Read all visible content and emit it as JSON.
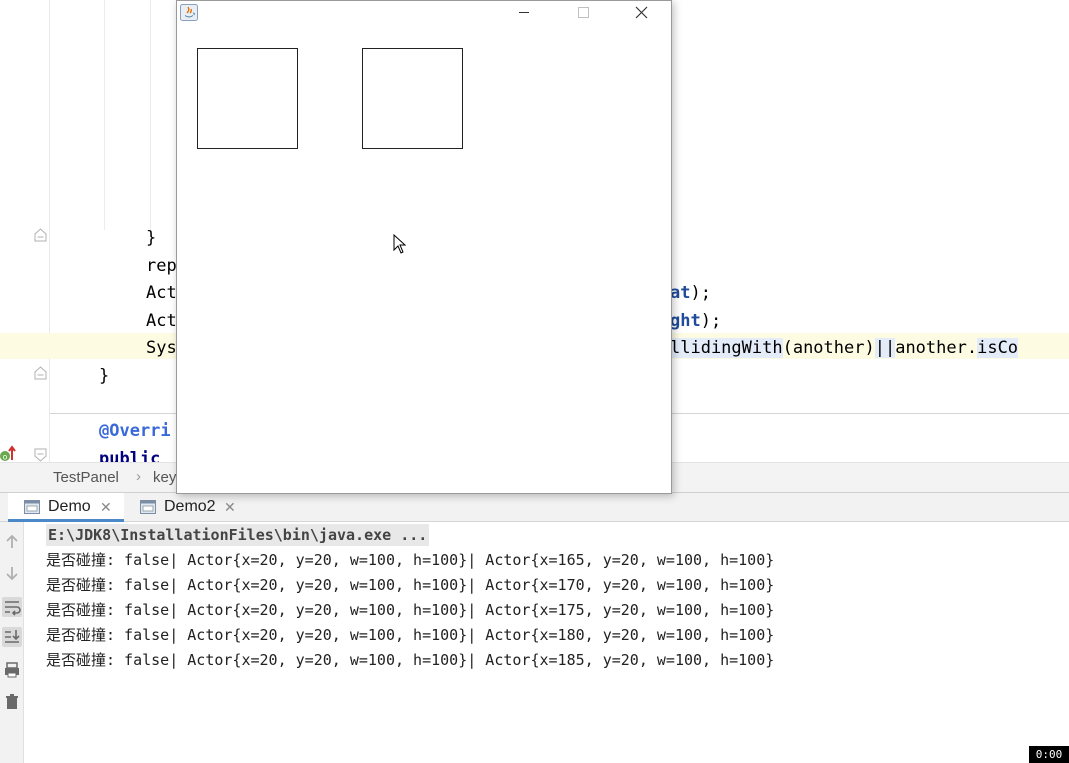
{
  "editor": {
    "lines": [
      {
        "text": "}"
      },
      {
        "text": "rep"
      },
      {
        "text": "Act"
      },
      {
        "text": "at",
        "suffix": ");"
      },
      {
        "text": "Act"
      },
      {
        "text": "ght",
        "suffix": ");"
      },
      {
        "text": "Sys"
      },
      {
        "pre": "llidingWith",
        "mid": "(another)",
        "pipes": "||",
        "tail": "another.",
        "hltail": "isCo"
      },
      {
        "text": "}"
      },
      {
        "text": "@Overri"
      },
      {
        "text": "public"
      }
    ]
  },
  "breadcrumb": {
    "items": [
      "TestPanel",
      "key"
    ]
  },
  "run": {
    "tabs": [
      {
        "label": "Demo",
        "active": true
      },
      {
        "label": "Demo2",
        "active": false
      }
    ],
    "command": "E:\\JDK8\\InstallationFiles\\bin\\java.exe ...",
    "output": [
      "是否碰撞: false| Actor{x=20, y=20, w=100, h=100}| Actor{x=165, y=20, w=100, h=100}",
      "是否碰撞: false| Actor{x=20, y=20, w=100, h=100}| Actor{x=170, y=20, w=100, h=100}",
      "是否碰撞: false| Actor{x=20, y=20, w=100, h=100}| Actor{x=175, y=20, w=100, h=100}",
      "是否碰撞: false| Actor{x=20, y=20, w=100, h=100}| Actor{x=180, y=20, w=100, h=100}",
      "是否碰撞: false| Actor{x=20, y=20, w=100, h=100}| Actor{x=185, y=20, w=100, h=100}"
    ],
    "toolbar": [
      "up-arrow-icon",
      "down-arrow-icon",
      "soft-wrap-icon",
      "scroll-to-end-icon",
      "print-icon",
      "trash-icon"
    ]
  },
  "app_window": {
    "title": "",
    "buttons": [
      "minimize",
      "maximize",
      "close"
    ]
  },
  "recording": {
    "timer": "0:00"
  },
  "colors": {
    "tab_underline": "#4a88c7",
    "current_line": "#fdfce3",
    "keyword": "#000080"
  }
}
